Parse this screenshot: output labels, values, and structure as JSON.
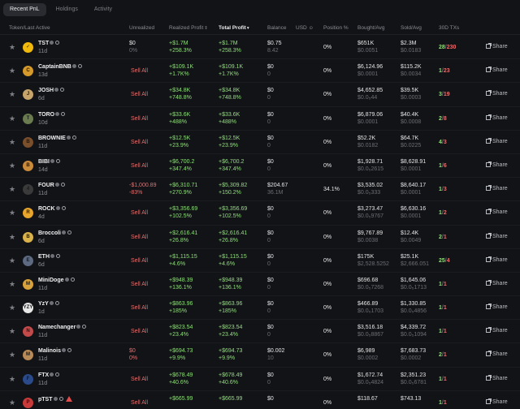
{
  "tabs": [
    "Recent PnL",
    "Holdings",
    "Activity"
  ],
  "headers": {
    "token": "Token/Last Active",
    "unrealized": "Unrealized",
    "realized": "Realized Profit",
    "total": "Total Profit",
    "balance": "Balance",
    "usd": "USD",
    "position": "Position %",
    "bought": "Bought",
    "avg": "/Avg",
    "sold": "Sold",
    "tx": "30D TXs"
  },
  "share_label": "Share",
  "rows": [
    {
      "name": "TST",
      "age": "11d",
      "unreal_a": "$0",
      "unreal_b": "0%",
      "unreal_color": "white",
      "real_a": "+$1.7M",
      "real_b": "+258.3%",
      "total_a": "+$1.7M",
      "total_b": "+258.3%",
      "bal_a": "$0.75",
      "bal_b": "8.42",
      "pos": "0%",
      "bought_a": "$651K",
      "bought_b": "$0.0051",
      "sold_a": "$2.3M",
      "sold_b": "$0.0183",
      "tx_a": "28",
      "tx_b": "230",
      "avatar": "✓"
    },
    {
      "name": "CaptainBNB",
      "age": "13d",
      "unreal_a": "Sell All",
      "unreal_b": "",
      "unreal_color": "sell",
      "real_a": "+$109.1K",
      "real_b": "+1.7K%",
      "total_a": "+$109.1K",
      "total_b": "+1.7K%",
      "bal_a": "$0",
      "bal_b": "0",
      "pos": "0%",
      "bought_a": "$6,124.96",
      "bought_b": "$0.0001",
      "sold_a": "$115.2K",
      "sold_b": "$0.0034",
      "tx_a": "1",
      "tx_b": "23",
      "avatar": "C"
    },
    {
      "name": "JOSH",
      "age": "6d",
      "unreal_a": "Sell All",
      "unreal_b": "",
      "unreal_color": "sell",
      "real_a": "+$34.8K",
      "real_b": "+748.8%",
      "total_a": "+$34.8K",
      "total_b": "+748.8%",
      "bal_a": "$0",
      "bal_b": "0",
      "pos": "0%",
      "bought_a": "$4,652.85",
      "bought_b": "$0.0₅44",
      "sold_a": "$39.5K",
      "sold_b": "$0.0003",
      "tx_a": "3",
      "tx_b": "19",
      "avatar": "J"
    },
    {
      "name": "TORO",
      "age": "10d",
      "unreal_a": "Sell All",
      "unreal_b": "",
      "unreal_color": "sell",
      "real_a": "+$33.6K",
      "real_b": "+488%",
      "total_a": "+$33.6K",
      "total_b": "+488%",
      "bal_a": "$0",
      "bal_b": "0",
      "pos": "0%",
      "bought_a": "$6,879.06",
      "bought_b": "$0.0001",
      "sold_a": "$40.4K",
      "sold_b": "$0.0008",
      "tx_a": "2",
      "tx_b": "8",
      "avatar": "T"
    },
    {
      "name": "BROWNIE",
      "age": "11d",
      "unreal_a": "Sell All",
      "unreal_b": "",
      "unreal_color": "sell",
      "real_a": "+$12.5K",
      "real_b": "+23.9%",
      "total_a": "+$12.5K",
      "total_b": "+23.9%",
      "bal_a": "$0",
      "bal_b": "0",
      "pos": "0%",
      "bought_a": "$52.2K",
      "bought_b": "$0.0182",
      "sold_a": "$64.7K",
      "sold_b": "$0.0225",
      "tx_a": "4",
      "tx_b": "3",
      "avatar": "B"
    },
    {
      "name": "BIBI",
      "age": "14d",
      "unreal_a": "Sell All",
      "unreal_b": "",
      "unreal_color": "sell",
      "real_a": "+$6,700.2",
      "real_b": "+347.4%",
      "total_a": "+$6,700.2",
      "total_b": "+347.4%",
      "bal_a": "$0",
      "bal_b": "0",
      "pos": "0%",
      "bought_a": "$1,928.71",
      "bought_b": "$0.0₅2615",
      "sold_a": "$8,628.91",
      "sold_b": "$0.0001",
      "tx_a": "1",
      "tx_b": "6",
      "avatar": "B"
    },
    {
      "name": "FOUR",
      "age": "11d",
      "unreal_a": "-$1,000.89",
      "unreal_b": "-83%",
      "unreal_color": "red",
      "real_a": "+$6,310.71",
      "real_b": "+270.9%",
      "total_a": "+$5,309.82",
      "total_b": "+150.2%",
      "bal_a": "$204.67",
      "bal_b": "36.1M",
      "pos": "34.1%",
      "bought_a": "$3,535.02",
      "bought_b": "$0.0₅333",
      "sold_a": "$8,640.17",
      "sold_b": "$0.0001",
      "tx_a": "1",
      "tx_b": "3",
      "avatar": "4"
    },
    {
      "name": "ROCK",
      "age": "4d",
      "unreal_a": "Sell All",
      "unreal_b": "",
      "unreal_color": "sell",
      "real_a": "+$3,356.69",
      "real_b": "+102.5%",
      "total_a": "+$3,356.69",
      "total_b": "+102.5%",
      "bal_a": "$0",
      "bal_b": "0",
      "pos": "0%",
      "bought_a": "$3,273.47",
      "bought_b": "$0.0₅9767",
      "sold_a": "$6,630.16",
      "sold_b": "$0.0001",
      "tx_a": "1",
      "tx_b": "2",
      "avatar": "R"
    },
    {
      "name": "Broccoli",
      "age": "6d",
      "unreal_a": "Sell All",
      "unreal_b": "",
      "unreal_color": "sell",
      "real_a": "+$2,616.41",
      "real_b": "+26.8%",
      "total_a": "+$2,616.41",
      "total_b": "+26.8%",
      "bal_a": "$0",
      "bal_b": "0",
      "pos": "0%",
      "bought_a": "$9,767.89",
      "bought_b": "$0.0038",
      "sold_a": "$12.4K",
      "sold_b": "$0.0049",
      "tx_a": "2",
      "tx_b": "1",
      "avatar": "B"
    },
    {
      "name": "ETH",
      "age": "6d",
      "unreal_a": "Sell All",
      "unreal_b": "",
      "unreal_color": "sell",
      "real_a": "+$1,115.15",
      "real_b": "+4.6%",
      "total_a": "+$1,115.15",
      "total_b": "+4.6%",
      "bal_a": "$0",
      "bal_b": "0",
      "pos": "0%",
      "bought_a": "$175K",
      "bought_b": "$2,528.5252",
      "sold_a": "$25.1K",
      "sold_b": "$2,666.051",
      "tx_a": "25",
      "tx_b": "4",
      "avatar": "E"
    },
    {
      "name": "MiniDoge",
      "age": "11d",
      "unreal_a": "Sell All",
      "unreal_b": "",
      "unreal_color": "sell",
      "real_a": "+$948.39",
      "real_b": "+136.1%",
      "total_a": "+$948.39",
      "total_b": "+136.1%",
      "bal_a": "$0",
      "bal_b": "0",
      "pos": "0%",
      "bought_a": "$696.68",
      "bought_b": "$0.0₅7268",
      "sold_a": "$1,645.06",
      "sold_b": "$0.0₅1713",
      "tx_a": "1",
      "tx_b": "1",
      "avatar": "M"
    },
    {
      "name": "YzY",
      "age": "1d",
      "unreal_a": "Sell All",
      "unreal_b": "",
      "unreal_color": "sell",
      "real_a": "+$863.96",
      "real_b": "+185%",
      "total_a": "+$863.96",
      "total_b": "+185%",
      "bal_a": "$0",
      "bal_b": "0",
      "pos": "0%",
      "bought_a": "$466.89",
      "bought_b": "$0.0₅1703",
      "sold_a": "$1,330.85",
      "sold_b": "$0.0₅4856",
      "tx_a": "1",
      "tx_b": "1",
      "avatar": "YZY"
    },
    {
      "name": "Namechanger",
      "age": "11d",
      "unreal_a": "Sell All",
      "unreal_b": "",
      "unreal_color": "sell",
      "real_a": "+$823.54",
      "real_b": "+23.4%",
      "total_a": "+$823.54",
      "total_b": "+23.4%",
      "bal_a": "$0",
      "bal_b": "0",
      "pos": "0%",
      "bought_a": "$3,516.18",
      "bought_b": "$0.0₅8867",
      "sold_a": "$4,339.72",
      "sold_b": "$0.0₅1094",
      "tx_a": "1",
      "tx_b": "1",
      "avatar": "N"
    },
    {
      "name": "Malinois",
      "age": "11d",
      "unreal_a": "$0",
      "unreal_b": "0%",
      "unreal_color": "red",
      "real_a": "+$694.73",
      "real_b": "+9.9%",
      "total_a": "+$694.73",
      "total_b": "+9.9%",
      "bal_a": "$0.002",
      "bal_b": "10",
      "pos": "0%",
      "bought_a": "$6,989",
      "bought_b": "$0.0002",
      "sold_a": "$7,683.73",
      "sold_b": "$0.0002",
      "tx_a": "2",
      "tx_b": "1",
      "avatar": "M"
    },
    {
      "name": "FTX",
      "age": "11d",
      "unreal_a": "Sell All",
      "unreal_b": "",
      "unreal_color": "sell",
      "real_a": "+$678.49",
      "real_b": "+40.6%",
      "total_a": "+$678.49",
      "total_b": "+40.6%",
      "bal_a": "$0",
      "bal_b": "0",
      "pos": "0%",
      "bought_a": "$1,672.74",
      "bought_b": "$0.0₅4824",
      "sold_a": "$2,351.23",
      "sold_b": "$0.0₅6781",
      "tx_a": "1",
      "tx_b": "1",
      "avatar": "F"
    },
    {
      "name": "pTST",
      "age": "",
      "unreal_a": "Sell All",
      "unreal_b": "",
      "unreal_color": "sell",
      "real_a": "+$665.99",
      "real_b": "",
      "total_a": "+$665.99",
      "total_b": "",
      "bal_a": "$0",
      "bal_b": "",
      "pos": "0%",
      "bought_a": "$118.67",
      "bought_b": "",
      "sold_a": "$743.13",
      "sold_b": "",
      "tx_a": "1",
      "tx_b": "1",
      "avatar": "P",
      "warn": true
    }
  ]
}
